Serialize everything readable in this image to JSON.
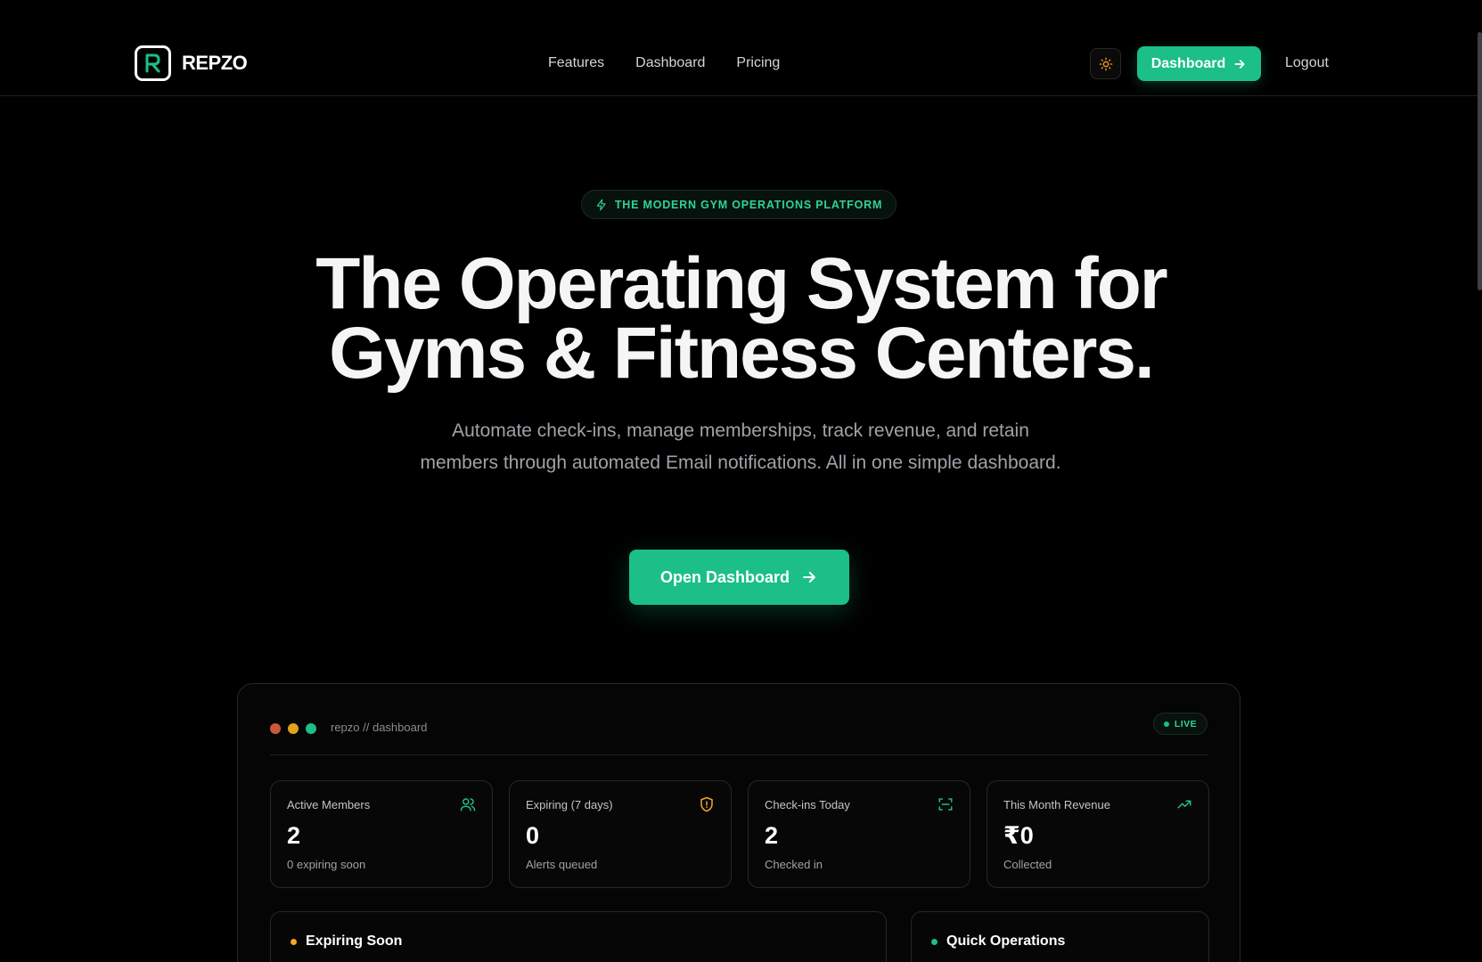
{
  "nav": {
    "brand": "REPZO",
    "links": [
      "Features",
      "Dashboard",
      "Pricing"
    ],
    "dashboard_button": "Dashboard",
    "logout": "Logout",
    "theme_icon": "sun-icon"
  },
  "hero": {
    "pill": "THE MODERN GYM OPERATIONS PLATFORM",
    "title_line1": "The Operating System for",
    "title_line2": "Gyms & Fitness Centers.",
    "subtitle": "Automate check-ins, manage memberships, track revenue, and retain members through automated Email notifications. All in one simple dashboard.",
    "cta": "Open Dashboard"
  },
  "preview": {
    "path": "repzo // dashboard",
    "live": "LIVE",
    "stats": [
      {
        "label": "Active Members",
        "value": "2",
        "note": "0 expiring soon",
        "icon": "users-icon"
      },
      {
        "label": "Expiring (7 days)",
        "value": "0",
        "note": "Alerts queued",
        "icon": "shield-alert-icon"
      },
      {
        "label": "Check-ins Today",
        "value": "2",
        "note": "Checked in",
        "icon": "scan-icon"
      },
      {
        "label": "This Month Revenue",
        "value": "₹0",
        "note": "Collected",
        "icon": "trending-up-icon"
      }
    ],
    "expiring_title": "Expiring Soon",
    "quick_title": "Quick Operations"
  },
  "colors": {
    "accent": "#1bbf87",
    "background": "#000000",
    "dot_red": "#e0603a",
    "dot_yellow": "#f5a623",
    "dot_green": "#1bbf87"
  }
}
